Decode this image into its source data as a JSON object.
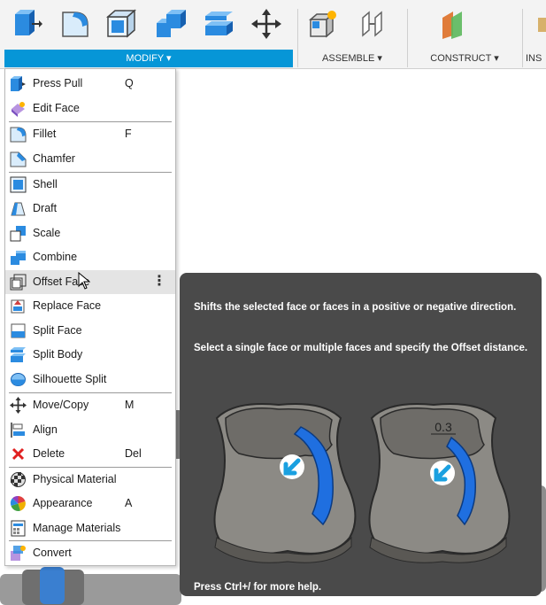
{
  "toolbar": {
    "groups": [
      {
        "label": "MODIFY ▾"
      },
      {
        "label": "ASSEMBLE ▾"
      },
      {
        "label": "CONSTRUCT ▾"
      },
      {
        "label": "INS"
      }
    ],
    "tools": [
      {
        "icon": "press-pull-icon"
      },
      {
        "icon": "fillet-icon"
      },
      {
        "icon": "shell-icon"
      },
      {
        "icon": "combine-icon"
      },
      {
        "icon": "split-body-icon"
      },
      {
        "icon": "move-icon"
      },
      {
        "icon": "new-component-icon"
      },
      {
        "icon": "joint-icon"
      },
      {
        "icon": "offset-plane-icon"
      }
    ]
  },
  "menu": {
    "items": [
      {
        "label": "Press Pull",
        "key": "Q",
        "icon": "press-pull-icon"
      },
      {
        "label": "Edit Face",
        "key": "",
        "icon": "edit-face-icon"
      },
      {
        "label": "Fillet",
        "key": "F",
        "icon": "fillet-icon"
      },
      {
        "label": "Chamfer",
        "key": "",
        "icon": "chamfer-icon"
      },
      {
        "label": "Shell",
        "key": "",
        "icon": "shell-icon"
      },
      {
        "label": "Draft",
        "key": "",
        "icon": "draft-icon"
      },
      {
        "label": "Scale",
        "key": "",
        "icon": "scale-icon"
      },
      {
        "label": "Combine",
        "key": "",
        "icon": "combine-icon"
      },
      {
        "label": "Offset Face",
        "key": "",
        "icon": "offset-face-icon",
        "more": "⋮"
      },
      {
        "label": "Replace Face",
        "key": "",
        "icon": "replace-face-icon"
      },
      {
        "label": "Split Face",
        "key": "",
        "icon": "split-face-icon"
      },
      {
        "label": "Split Body",
        "key": "",
        "icon": "split-body-icon"
      },
      {
        "label": "Silhouette Split",
        "key": "",
        "icon": "silhouette-split-icon"
      },
      {
        "label": "Move/Copy",
        "key": "M",
        "icon": "move-copy-icon"
      },
      {
        "label": "Align",
        "key": "",
        "icon": "align-icon"
      },
      {
        "label": "Delete",
        "key": "Del",
        "icon": "delete-icon"
      },
      {
        "label": "Physical Material",
        "key": "",
        "icon": "physical-material-icon"
      },
      {
        "label": "Appearance",
        "key": "A",
        "icon": "appearance-icon"
      },
      {
        "label": "Manage Materials",
        "key": "",
        "icon": "manage-materials-icon"
      },
      {
        "label": "Convert",
        "key": "",
        "icon": "convert-icon"
      }
    ]
  },
  "tooltip": {
    "line1": "Shifts the selected face or faces in a positive or negative direction.",
    "line2": "Select a single face or multiple faces and specify the Offset distance.",
    "dimension": "0.3",
    "help": "Press Ctrl+/ for more help."
  },
  "colors": {
    "accent": "#0696d7",
    "tooltip_bg": "#4a4a4a",
    "highlight_face": "#1f6fe0"
  }
}
